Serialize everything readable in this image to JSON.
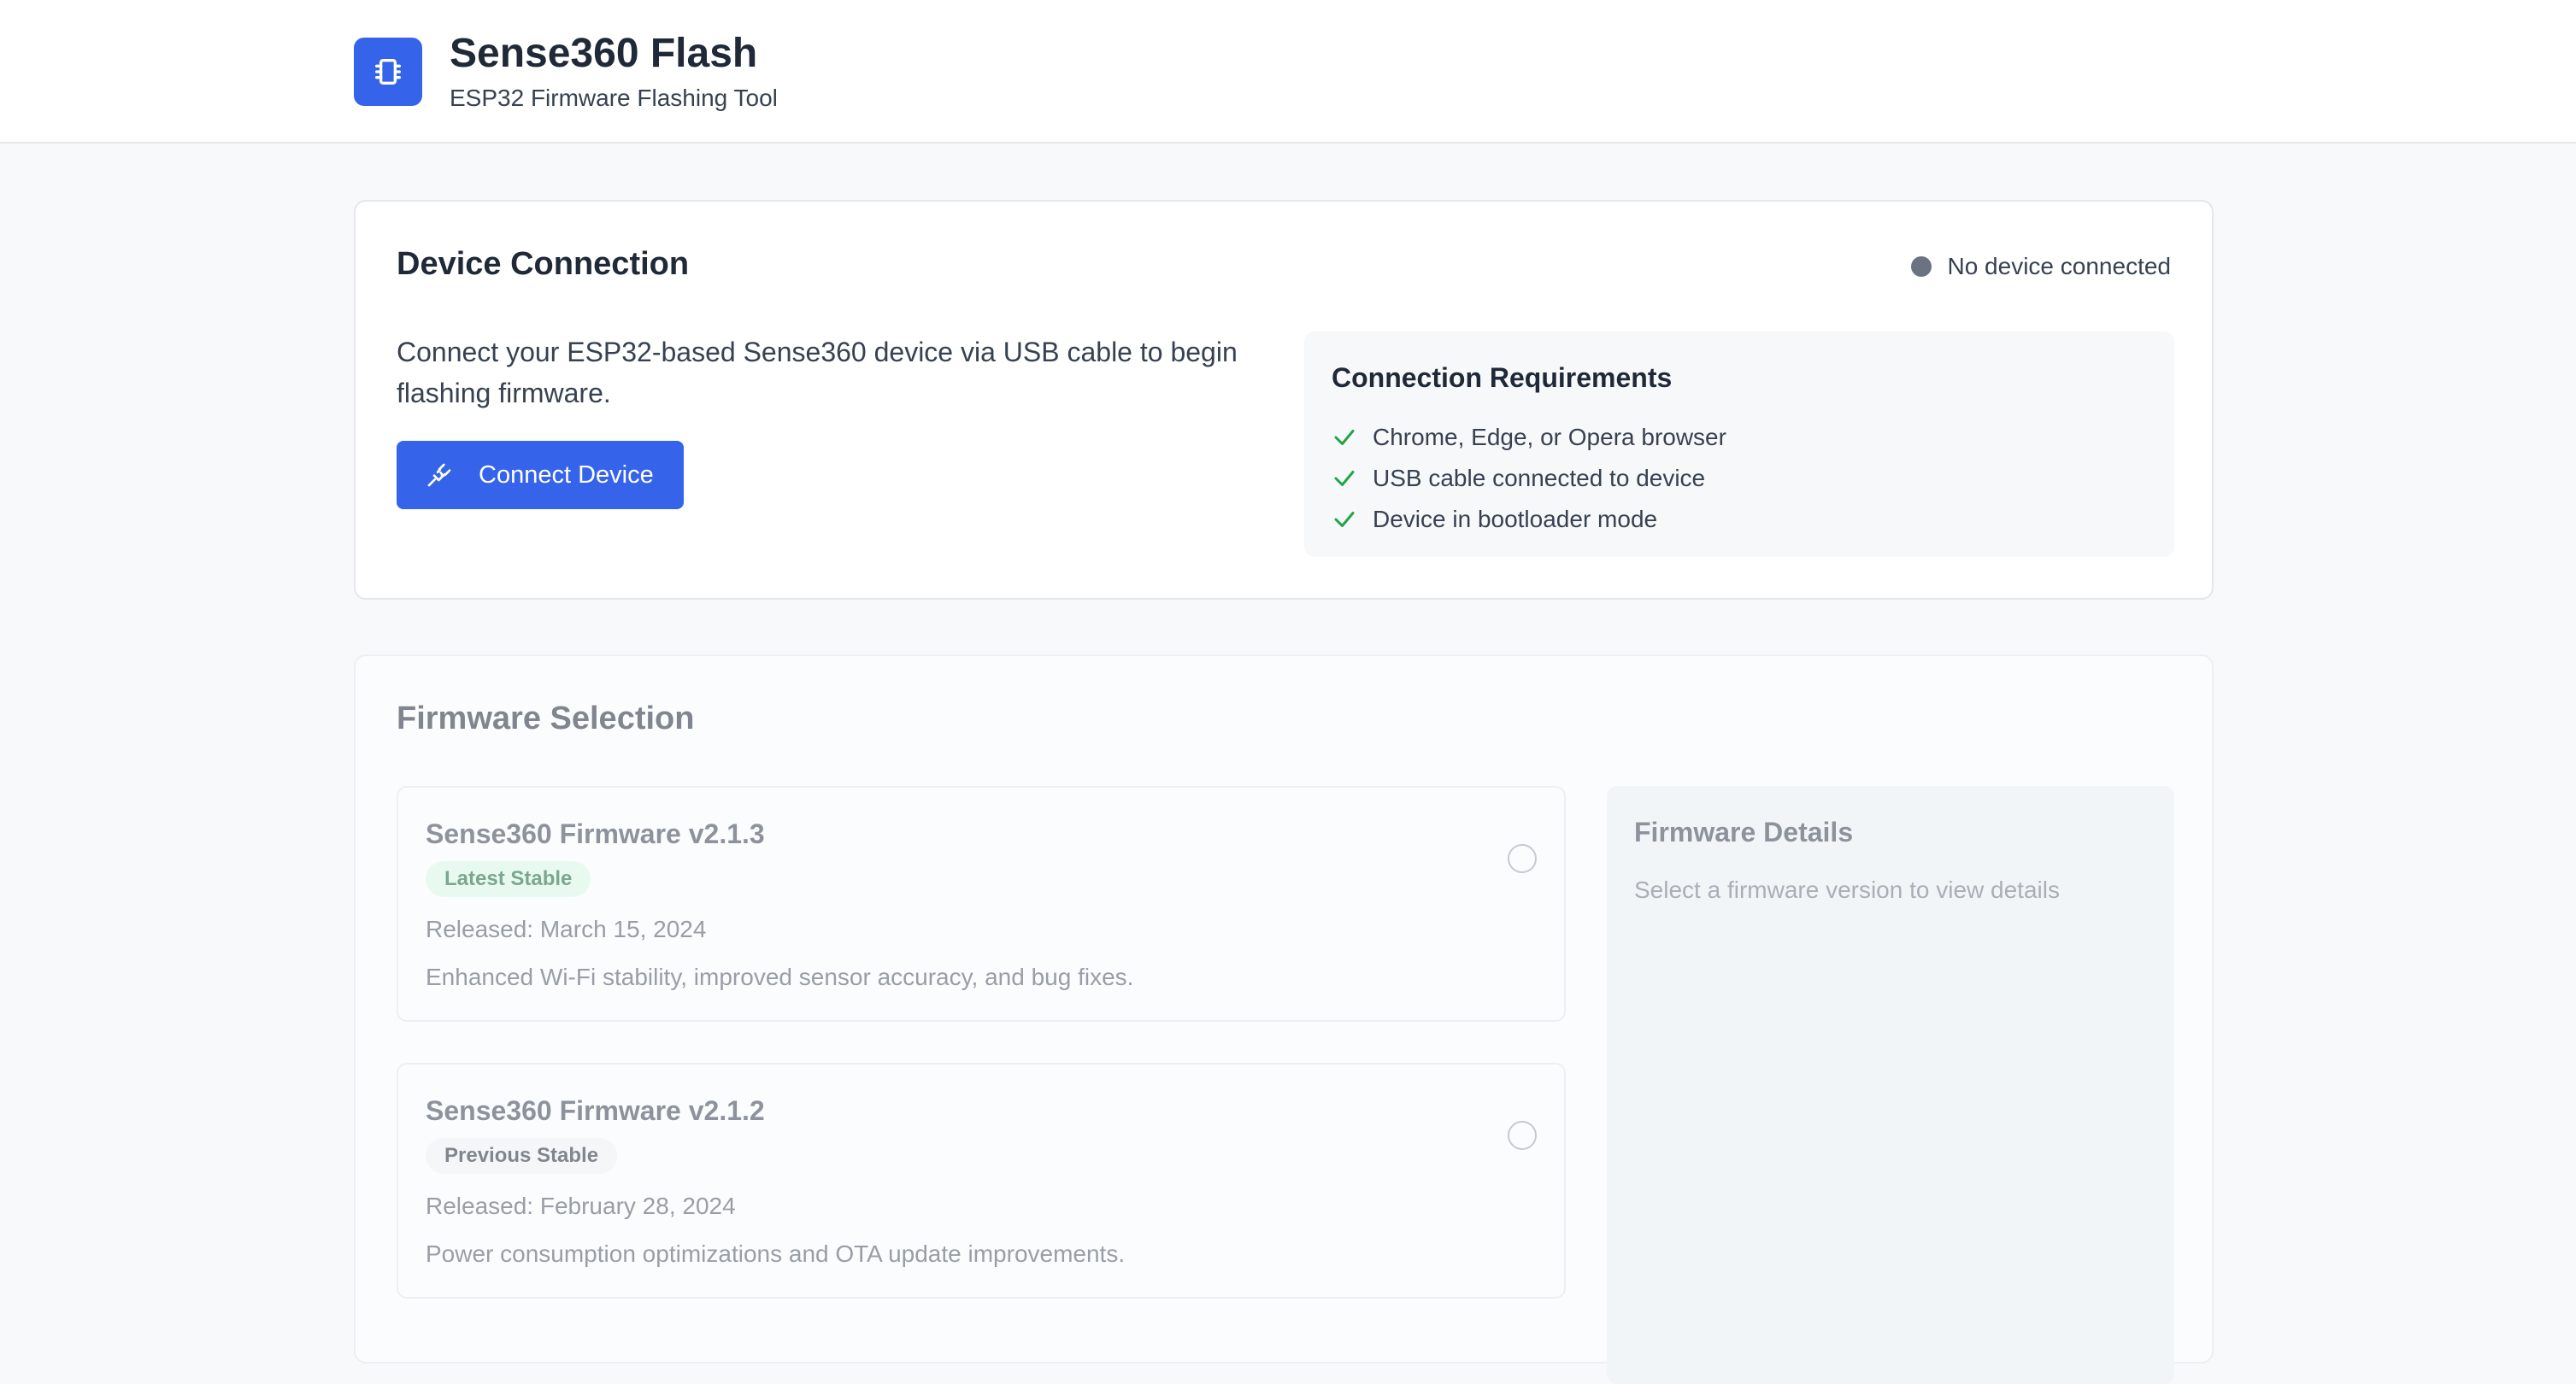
{
  "header": {
    "title": "Sense360 Flash",
    "subtitle": "ESP32 Firmware Flashing Tool",
    "logo_icon": "chip-icon",
    "brand_color": "#3563e9"
  },
  "connection": {
    "title": "Device Connection",
    "status_text": "No device connected",
    "status_color": "#6b7280",
    "description": "Connect your ESP32-based Sense360 device via USB cable to begin flashing firmware.",
    "connect_button_label": "Connect Device",
    "connect_icon": "plug-icon",
    "requirements": {
      "title": "Connection Requirements",
      "items": [
        "Chrome, Edge, or Opera browser",
        "USB cable connected to device",
        "Device in bootloader mode"
      ],
      "check_color": "#22a447"
    }
  },
  "firmware": {
    "title": "Firmware Selection",
    "items": [
      {
        "name": "Sense360 Firmware v2.1.3",
        "badge": "Latest Stable",
        "released": "Released: March 15, 2024",
        "description": "Enhanced Wi-Fi stability, improved sensor accuracy, and bug fixes."
      },
      {
        "name": "Sense360 Firmware v2.1.2",
        "badge": "Previous Stable",
        "released": "Released: February 28, 2024",
        "description": "Power consumption optimizations and OTA update improvements."
      }
    ],
    "details": {
      "title": "Firmware Details",
      "hint": "Select a firmware version to view details"
    }
  }
}
